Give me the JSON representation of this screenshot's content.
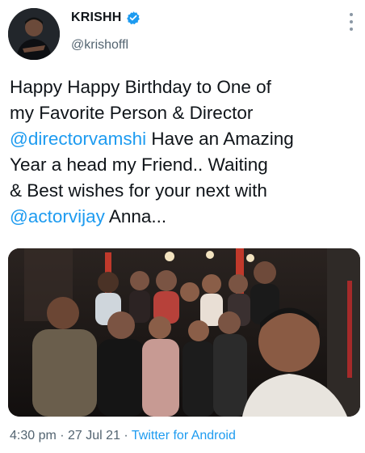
{
  "tweet": {
    "author": {
      "display_name": "KRISHH",
      "handle": "@krishoffl",
      "verified": true,
      "verified_color": "#1d9bf0"
    },
    "text_lines": [
      {
        "parts": [
          {
            "text": "Happy Happy Birthday to One of",
            "mention": false
          }
        ]
      },
      {
        "parts": [
          {
            "text": "my Favorite Person & Director",
            "mention": false
          }
        ]
      },
      {
        "parts": [
          {
            "text": "@directorvamshi",
            "mention": true
          },
          {
            "text": " Have an Amazing",
            "mention": false
          }
        ]
      },
      {
        "parts": [
          {
            "text": "Year a head my Friend.. Waiting",
            "mention": false
          }
        ]
      },
      {
        "parts": [
          {
            "text": "& Best wishes for your next with",
            "mention": false
          }
        ]
      },
      {
        "parts": [
          {
            "text": "@actorvijay",
            "mention": true
          },
          {
            "text": " Anna...",
            "mention": false
          }
        ]
      }
    ],
    "media": {
      "type": "photo"
    },
    "time": "4:30 pm",
    "separator": " · ",
    "date": "27 Jul 21",
    "source": "Twitter for Android",
    "mention_color": "#1d9bf0",
    "icons": {
      "more": "more-vertical-icon",
      "verified": "verified-badge-icon"
    }
  }
}
